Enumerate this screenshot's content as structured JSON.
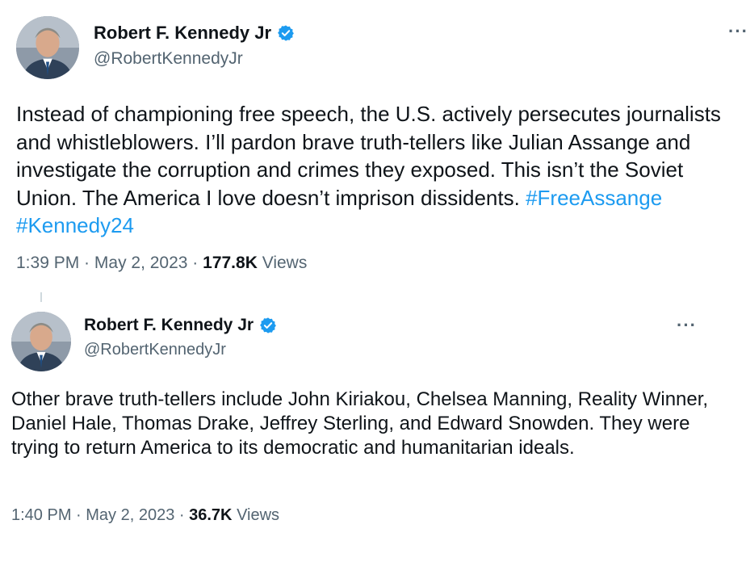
{
  "tweets": [
    {
      "author_name": "Robert F. Kennedy Jr",
      "handle": "@RobertKennedyJr",
      "text": "Instead of championing free speech, the U.S. actively persecutes journalists and whistleblowers. I’ll pardon brave truth-tellers like Julian Assange and investigate the corruption and crimes they exposed. This isn’t the Soviet Union. The America I love doesn’t imprison dissidents.",
      "hashtags": [
        "#FreeAssange",
        "#Kennedy24"
      ],
      "time": "1:39 PM",
      "separator": " · ",
      "date": "May 2, 2023",
      "views_count": "177.8K",
      "views_label": "Views",
      "more_icon": "more-options-icon",
      "verified_icon": "verified-badge-icon"
    },
    {
      "author_name": "Robert F. Kennedy Jr",
      "handle": "@RobertKennedyJr",
      "text": "Other brave truth-tellers include John Kiriakou, Chelsea Manning, Reality Winner, Daniel Hale, Thomas Drake, Jeffrey Sterling, and Edward Snowden. They were trying to return America to its democratic and humanitarian ideals.",
      "time": "1:40 PM",
      "separator": " · ",
      "date": "May 2, 2023",
      "views_count": "36.7K",
      "views_label": "Views",
      "more_icon": "more-options-icon",
      "verified_icon": "verified-badge-icon"
    }
  ],
  "colors": {
    "text": "#0f1419",
    "secondary": "#536471",
    "link": "#1d9bf0",
    "verified": "#1d9bf0"
  },
  "more_glyph": "···"
}
